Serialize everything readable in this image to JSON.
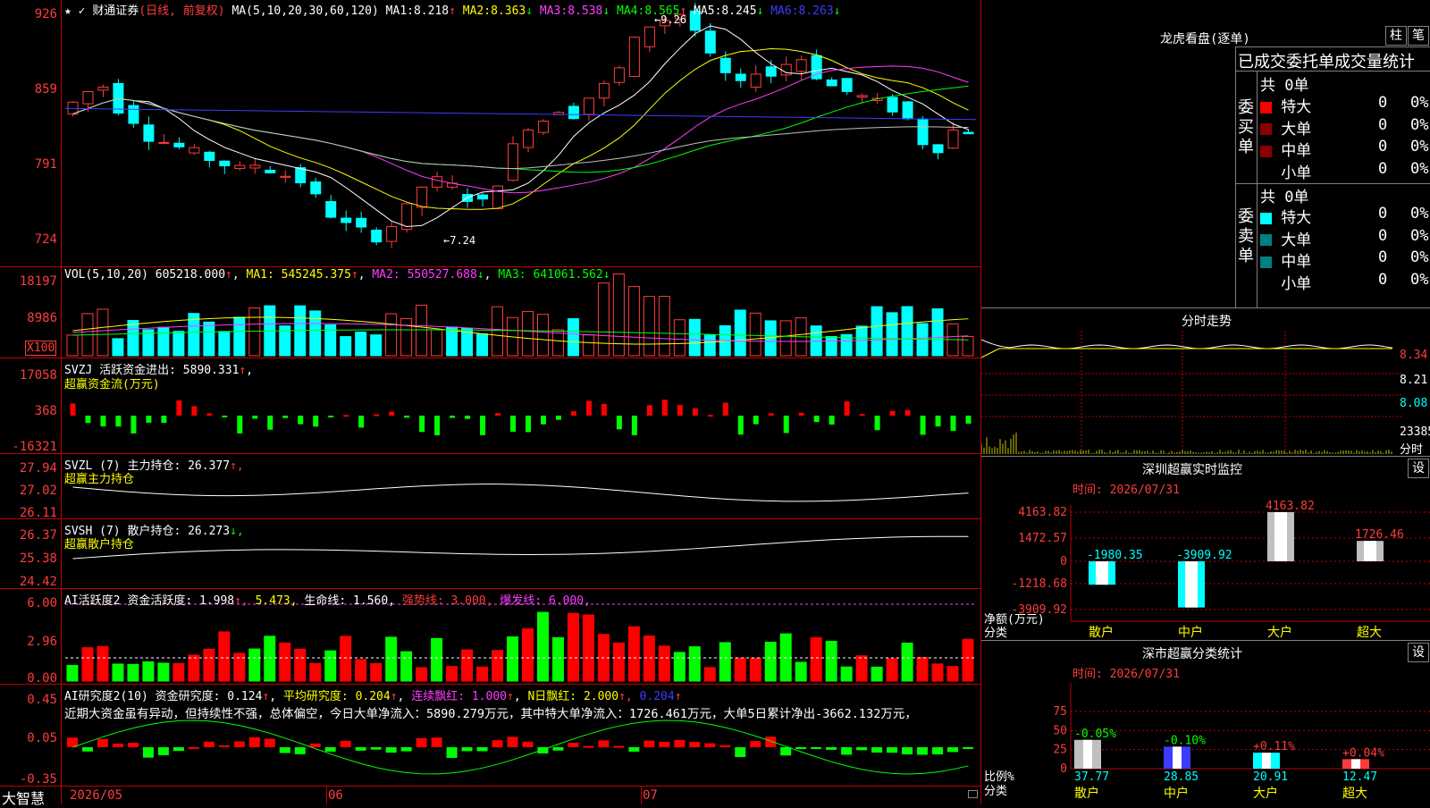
{
  "stock": {
    "name": "财通证券",
    "period": "(日线, 前复权)",
    "star": "★",
    "pin": "📌"
  },
  "colors": {
    "up": "#ff3c3c",
    "down": "#00ffff",
    "bg": "#000000",
    "grid": "#c00000"
  },
  "main": {
    "ma_label": "MA(5,10,20,30,60,120)",
    "ma": [
      {
        "label": "MA1:",
        "value": "8.218",
        "arrow": "↑"
      },
      {
        "label": "MA2:",
        "value": "8.363",
        "arrow": "↓"
      },
      {
        "label": "MA3:",
        "value": "8.538",
        "arrow": "↓"
      },
      {
        "label": "MA4:",
        "value": "8.565",
        "arrow": "↑"
      },
      {
        "label": "MA5:",
        "value": "8.245",
        "arrow": "↓"
      },
      {
        "label": "MA6:",
        "value": "8.263",
        "arrow": "↓"
      }
    ],
    "y_labels": [
      "926",
      "859",
      "791",
      "724"
    ],
    "high_note": "9.26",
    "low_note": "7.24"
  },
  "vol": {
    "title": "VOL(5,10,20)",
    "value": "605218.000",
    "arrow": "↑",
    "ma": [
      {
        "label": "MA1:",
        "value": "545245.375",
        "arrow": "↑"
      },
      {
        "label": "MA2:",
        "value": "550527.688",
        "arrow": "↓"
      },
      {
        "label": "MA3:",
        "value": "641061.562",
        "arrow": "↓"
      }
    ],
    "y_labels": [
      "18197",
      "8986"
    ],
    "unit": "X100"
  },
  "svzj": {
    "title": "SVZJ",
    "desc": "活跃资金进出:",
    "value": "5890.331",
    "arrow": "↑",
    "sub": "超赢资金流(万元)",
    "y_labels": [
      "17058",
      "368",
      "-16321"
    ]
  },
  "svzl": {
    "title": "SVZL (7)",
    "desc": "主力持仓:",
    "value": "26.377",
    "arrow": "↑,",
    "sub": "超赢主力持仓",
    "y_labels": [
      "27.94",
      "27.02",
      "26.11"
    ]
  },
  "svsh": {
    "title": "SVSH (7)",
    "desc": "散户持仓:",
    "value": "26.273",
    "arrow": "↓,",
    "sub": "超赢散户持仓",
    "y_labels": [
      "26.37",
      "25.38",
      "24.42"
    ]
  },
  "ai1": {
    "title": "AI活跃度2",
    "desc": "资金活跃度:",
    "v1": "1.998",
    "a1": "↑,",
    "v2": "5.473,",
    "desc2": "生命线:",
    "v3": "1.560,",
    "desc3": "强势线:",
    "v4": "3.000,",
    "desc4": "爆发线:",
    "v5": "6.000,",
    "y_labels": [
      "6.00",
      "2.96",
      "0.00"
    ]
  },
  "ai2": {
    "title": "AI研究度2(10)",
    "desc": "资金研究度:",
    "v1": "0.124",
    "a1": "↑",
    "desc2": "平均研究度:",
    "v2": "0.204",
    "a2": "↑",
    "desc3": "连续飘红:",
    "v3": "1.000",
    "a3": "↑",
    "desc4": "N日飘红:",
    "v4": "2.000",
    "a4": "↑,",
    "v5": "0.204",
    "a5": "↑",
    "comment": "近期大资金虽有异动，但持续性不强，总体偏空，今日大单净流入：5890.279万元，其中特大单净流入：1726.461万元，大单5日累计净出-3662.132万元，",
    "y_labels": [
      "0.45",
      "0.05",
      "-0.35"
    ]
  },
  "xaxis": {
    "labels": [
      "2026/05",
      "06",
      "07"
    ],
    "brand": "大智慧"
  },
  "longhu": {
    "title": "龙虎看盘(逐单)",
    "btn1": "柱",
    "btn2": "笔",
    "header": "已成交委托单成交量统计",
    "buy": {
      "label": "委买单",
      "total": "共 0单",
      "rows": [
        {
          "name": "特大",
          "val": "0",
          "pct": "0%",
          "color": "#ff0000"
        },
        {
          "name": "大单",
          "val": "0",
          "pct": "0%",
          "color": "#8b0000"
        },
        {
          "name": "中单",
          "val": "0",
          "pct": "0%",
          "color": "#8b0000"
        },
        {
          "name": "小单",
          "val": "0",
          "pct": "0%",
          "color": ""
        }
      ]
    },
    "sell": {
      "label": "委卖单",
      "total": "共 0单",
      "rows": [
        {
          "name": "特大",
          "val": "0",
          "pct": "0%",
          "color": "#00ffff"
        },
        {
          "name": "大单",
          "val": "0",
          "pct": "0%",
          "color": "#008080"
        },
        {
          "name": "中单",
          "val": "0",
          "pct": "0%",
          "color": "#008080"
        },
        {
          "name": "小单",
          "val": "0",
          "pct": "0%",
          "color": ""
        }
      ]
    }
  },
  "intraday": {
    "title": "分时走势",
    "y_labels": [
      "8.34",
      "8.21",
      "8.08"
    ],
    "vol_label": "23385",
    "vol_unit": "分时"
  },
  "monitor": {
    "title": "深圳超赢实时监控",
    "btn": "设",
    "time": "时间: 2026/07/31",
    "y_labels": [
      "4163.82",
      "1472.57",
      "0",
      "-1218.68",
      "-3909.92"
    ],
    "y_title": "净额(万元)",
    "x_title": "分类",
    "cats": [
      "散户",
      "中户",
      "大户",
      "超大"
    ],
    "values": [
      -1980.35,
      -3909.92,
      4163.82,
      1726.46
    ],
    "value_labels": [
      "-1980.35",
      "-3909.92",
      "4163.82",
      "1726.46"
    ]
  },
  "classify": {
    "title": "深市超赢分类统计",
    "btn": "设",
    "time": "时间: 2026/07/31",
    "y_labels": [
      "75",
      "50",
      "25",
      "0"
    ],
    "y_title": "比例%",
    "x_title": "分类",
    "cats": [
      "散户",
      "中户",
      "大户",
      "超大"
    ],
    "values": [
      37.77,
      28.85,
      20.91,
      12.47
    ],
    "change_labels": [
      "-0.05%",
      "-0.10%",
      "+0.11%",
      "+0.04%"
    ]
  }
}
